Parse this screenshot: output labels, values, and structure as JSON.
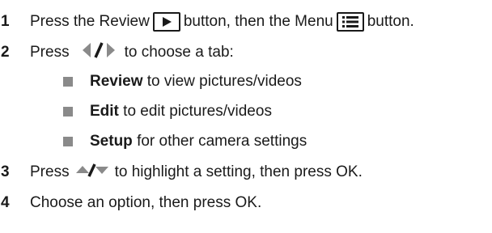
{
  "steps": [
    {
      "number": "1",
      "parts": {
        "a": "Press the Review",
        "b": "button, then the Menu",
        "c": "button."
      },
      "icons": [
        "review-play-icon",
        "menu-list-icon"
      ]
    },
    {
      "number": "2",
      "parts": {
        "a": "Press",
        "b": "to choose a tab:"
      },
      "icons": [
        "left-right-arrows-icon"
      ],
      "bullets": [
        {
          "bold": "Review",
          "text": "to view pictures/videos"
        },
        {
          "bold": "Edit",
          "text": "to edit pictures/videos"
        },
        {
          "bold": "Setup",
          "text": "for other camera settings"
        }
      ]
    },
    {
      "number": "3",
      "parts": {
        "a": "Press",
        "b": "to highlight a setting, then press OK."
      },
      "icons": [
        "up-down-arrows-icon"
      ]
    },
    {
      "number": "4",
      "parts": {
        "a": "Choose an option, then press OK."
      }
    }
  ]
}
